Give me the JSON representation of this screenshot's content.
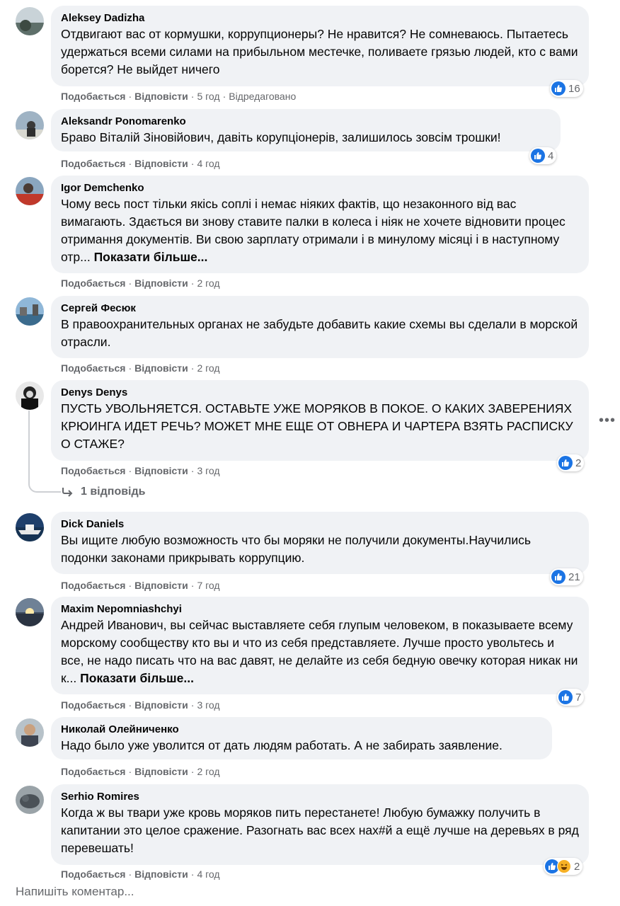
{
  "ui": {
    "like_label": "Подобається",
    "reply_label": "Відповісти",
    "dot": "·",
    "show_more": "Показати більше...",
    "write_comment": "Напишіть коментар..."
  },
  "comments": [
    {
      "author": "Aleksey Dadizha",
      "text": "Отдвигают вас от кормушки, коррупционеры? Не нравится? Не сомневаюсь. Пытаетесь удержаться всеми силами на прибыльном местечке, поливаете грязью людей, кто с вами борется? Не выйдет ничего",
      "time": "5 год",
      "edited": "Відредаговано",
      "reactions": "16"
    },
    {
      "author": "Aleksandr Ponomarenko",
      "text": "Браво Віталій Зіновійович, давіть корупціонерів, залишилось зовсім трошки!",
      "time": "4 год",
      "reactions": "4"
    },
    {
      "author": "Igor Demchenko",
      "text": "Чому весь пост тільки якісь соплі і немає ніяких фактів, що незаконного від вас вимагають. Здається ви знову ставите палки в колеса і ніяк не хочете відновити процес отримання документів. Ви свою зарплату отримали і в минулому місяці і в наступному отр...",
      "time": "2 год"
    },
    {
      "author": "Сергей Фесюк",
      "text": "В правоохранительных органах не забудьте добавить какие схемы вы сделали в морской отрасли.",
      "time": "2 год"
    },
    {
      "author": "Denys Denys",
      "text": "ПУСТЬ УВОЛЬНЯЕТСЯ. ОСТАВЬТЕ УЖЕ МОРЯКОВ В ПОКОЕ. О КАКИХ ЗАВЕРЕНИЯХ КРЮИНГА ИДЕТ РЕЧЬ? МОЖЕТ МНЕ ЕЩЕ ОТ ОВНЕРА И ЧАРТЕРА ВЗЯТЬ РАСПИСКУ О СТАЖЕ?",
      "time": "3 год",
      "reactions": "2",
      "replies": "1 відповідь"
    },
    {
      "author": "Dick Daniels",
      "text": "Вы ищите любую возможность что бы моряки не получили документы.Научились подонки законами прикрывать коррупцию.",
      "time": "7 год",
      "reactions": "21"
    },
    {
      "author": "Maxim Nepomniashchyi",
      "text": "Андрей Иванович, вы сейчас выставляете себя глупым человеком, в показываете всему морскому сообществу кто вы и что из себя представляете. Лучше просто увольтесь и все, не надо писать что на вас давят, не делайте из себя бедную овечку которая никак ни к...",
      "time": "3 год",
      "reactions": "7"
    },
    {
      "author": "Николай Олейниченко",
      "text": "Надо было уже уволится от дать людям работать. А не забирать заявление.",
      "time": "2 год"
    },
    {
      "author": "Serhio Romires",
      "text": "Когда ж вы твари уже кровь моряков пить перестанете! Любую бумажку получить в капитании это целое сражение. Разогнать вас всех нах#й а ещё лучше на деревьях в ряд перевешать!",
      "time": "4 год",
      "reactions": "2"
    }
  ],
  "colors": {
    "bubble": "#f0f2f5",
    "meta": "#65676b",
    "like_blue": "#1b74e4",
    "haha_yellow": "#f7b125"
  }
}
